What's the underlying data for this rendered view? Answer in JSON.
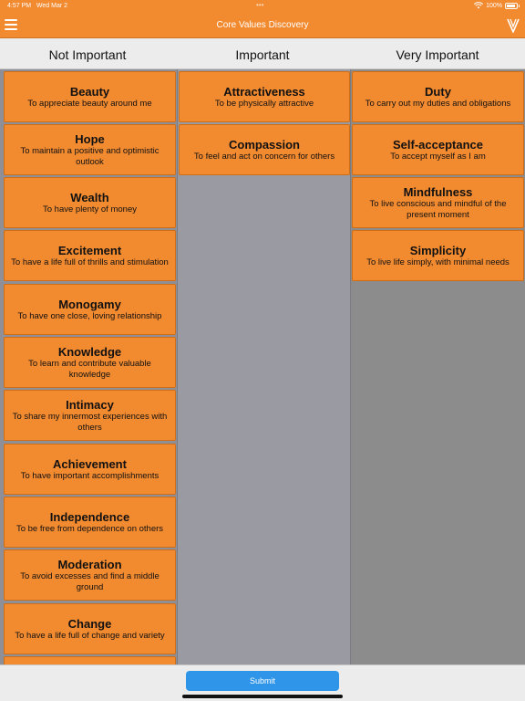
{
  "status_bar": {
    "time": "4:57 PM",
    "date": "Wed Mar 2",
    "multitask_dots": "•••",
    "battery": "100%",
    "wifi_icon": "wifi-icon",
    "battery_icon": "battery-icon"
  },
  "nav": {
    "title": "Core Values Discovery",
    "menu_icon": "hamburger-menu-icon",
    "logo_icon": "v-logo-icon"
  },
  "columns": [
    {
      "title": "Not Important",
      "cards": [
        {
          "title": "Beauty",
          "desc": "To appreciate beauty around me"
        },
        {
          "title": "Hope",
          "desc": "To maintain a positive and optimistic outlook"
        },
        {
          "title": "Wealth",
          "desc": "To have plenty of money"
        },
        {
          "title": "Excitement",
          "desc": "To have a life full of thrills and stimulation"
        },
        {
          "title": "Monogamy",
          "desc": "To have one close, loving relationship"
        },
        {
          "title": "Knowledge",
          "desc": "To learn and contribute valuable knowledge"
        },
        {
          "title": "Intimacy",
          "desc": "To share my innermost experiences with others"
        },
        {
          "title": "Achievement",
          "desc": "To have important accomplishments"
        },
        {
          "title": "Independence",
          "desc": "To be free from dependence on others"
        },
        {
          "title": "Moderation",
          "desc": "To avoid excesses and find a middle ground"
        },
        {
          "title": "Change",
          "desc": "To have a life full of change and variety"
        }
      ]
    },
    {
      "title": "Important",
      "cards": [
        {
          "title": "Attractiveness",
          "desc": "To be physically attractive"
        },
        {
          "title": "Compassion",
          "desc": "To feel and act on concern for others"
        }
      ]
    },
    {
      "title": "Very Important",
      "cards": [
        {
          "title": "Duty",
          "desc": "To carry out my duties and obligations"
        },
        {
          "title": "Self-acceptance",
          "desc": "To accept myself as I am"
        },
        {
          "title": "Mindfulness",
          "desc": "To live conscious and mindful of the present moment"
        },
        {
          "title": "Simplicity",
          "desc": "To live life simply, with minimal needs"
        }
      ]
    }
  ],
  "footer": {
    "submit_label": "Submit"
  },
  "colors": {
    "accent": "#f28a30",
    "button": "#2f95e8"
  }
}
